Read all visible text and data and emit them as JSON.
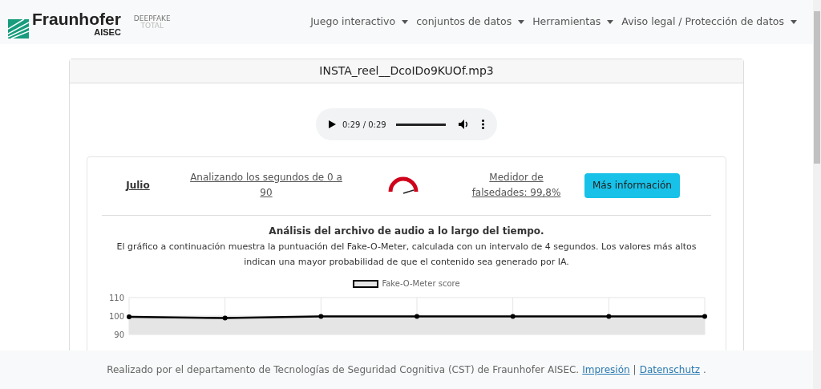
{
  "navbar": {
    "logo": {
      "name": "Fraunhofer",
      "sub": "AISEC"
    },
    "badge": {
      "line1": "DEEPFAKE",
      "line2": "TOTAL"
    },
    "menu": [
      {
        "label": "Juego interactivo"
      },
      {
        "label": "conjuntos de datos"
      },
      {
        "label": "Herramientas"
      },
      {
        "label": "Aviso legal / Protección de datos"
      }
    ]
  },
  "file_card": {
    "title": "INSTA_reel__DcoIDo9KUOf.mp3",
    "player": {
      "time": "0:29 / 0:29",
      "level": 1.0
    },
    "result": {
      "model": "Julio",
      "range": "Analizando los segundos de 0 a 90",
      "score": "Medidor de falsedades: 99,8%",
      "button": "Más información"
    },
    "analysis": {
      "heading": "Análisis del archivo de audio a lo largo del tiempo.",
      "text": "El gráfico a continuación muestra la puntuación del Fake-O-Meter, calculada con un intervalo de 4 segundos. Los valores más altos indican una mayor probabilidad de que el contenido sea generado por IA.",
      "chart_data": {
        "type": "area",
        "ylim": [
          90,
          110
        ],
        "yticks": [
          90,
          100,
          110
        ],
        "grid": true,
        "series": [
          {
            "name": "Fake-O-Meter score",
            "color": "#000000",
            "values": [
              99.6,
              98.9,
              99.8,
              99.8,
              99.8,
              99.8,
              99.8
            ]
          }
        ]
      }
    }
  },
  "footer": {
    "text": "Realizado por el departamento de Tecnologías de Seguridad Cognitiva (CST) de Fraunhofer AISEC.",
    "links": [
      "Impresión",
      "Datenschutz"
    ],
    "separator": "|",
    "end": "."
  }
}
